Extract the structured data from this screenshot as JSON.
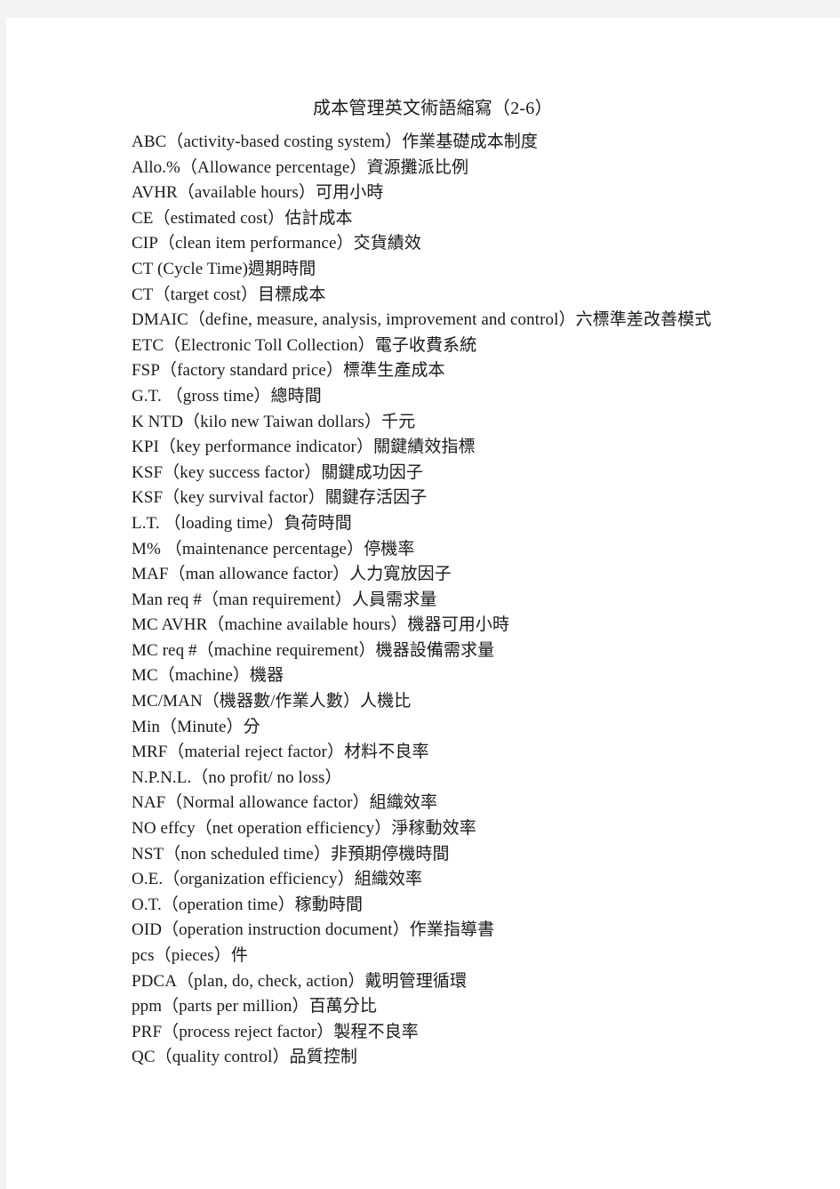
{
  "document": {
    "title": "成本管理英文術語縮寫（2-6）",
    "entries": [
      "ABC（activity-based costing system）作業基礎成本制度",
      "Allo.%（Allowance percentage）資源攤派比例",
      "AVHR（available hours）可用小時",
      "CE（estimated cost）估計成本",
      "CIP（clean item performance）交貨績效",
      "CT (Cycle Time)週期時間",
      "CT（target cost）目標成本",
      "DMAIC（define, measure, analysis, improvement and control）六標準差改善模式",
      "ETC（Electronic Toll Collection）電子收費系統",
      "FSP（factory standard price）標準生產成本",
      "G.T. （gross time）總時間",
      "K NTD（kilo new Taiwan dollars）千元",
      "KPI（key performance indicator）關鍵績效指標",
      "KSF（key success factor）關鍵成功因子",
      "KSF（key survival factor）關鍵存活因子",
      "L.T. （loading time）負荷時間",
      "M% （maintenance percentage）停機率",
      "MAF（man allowance factor）人力寬放因子",
      "Man req #（man requirement）人員需求量",
      "MC AVHR（machine available hours）機器可用小時",
      "MC req #（machine requirement）機器設備需求量",
      "MC（machine）機器",
      "MC/MAN（機器數/作業人數）人機比",
      "Min（Minute）分",
      "MRF（material reject factor）材料不良率",
      "N.P.N.L.（no profit/ no loss）",
      "NAF（Normal allowance factor）組織效率",
      "NO effcy（net operation efficiency）淨稼動效率",
      "NST（non scheduled time）非預期停機時間",
      "O.E.（organization efficiency）組織效率",
      "O.T.（operation time）稼動時間",
      "OID（operation instruction document）作業指導書",
      "pcs（pieces）件",
      "PDCA（plan, do, check, action）戴明管理循環",
      "ppm（parts per million）百萬分比",
      "PRF（process reject factor）製程不良率",
      "QC（quality control）品質控制"
    ]
  },
  "colors": {
    "page_background": "#ffffff",
    "viewer_margin": "#f3f3f3",
    "text": "#1a1a1a"
  }
}
